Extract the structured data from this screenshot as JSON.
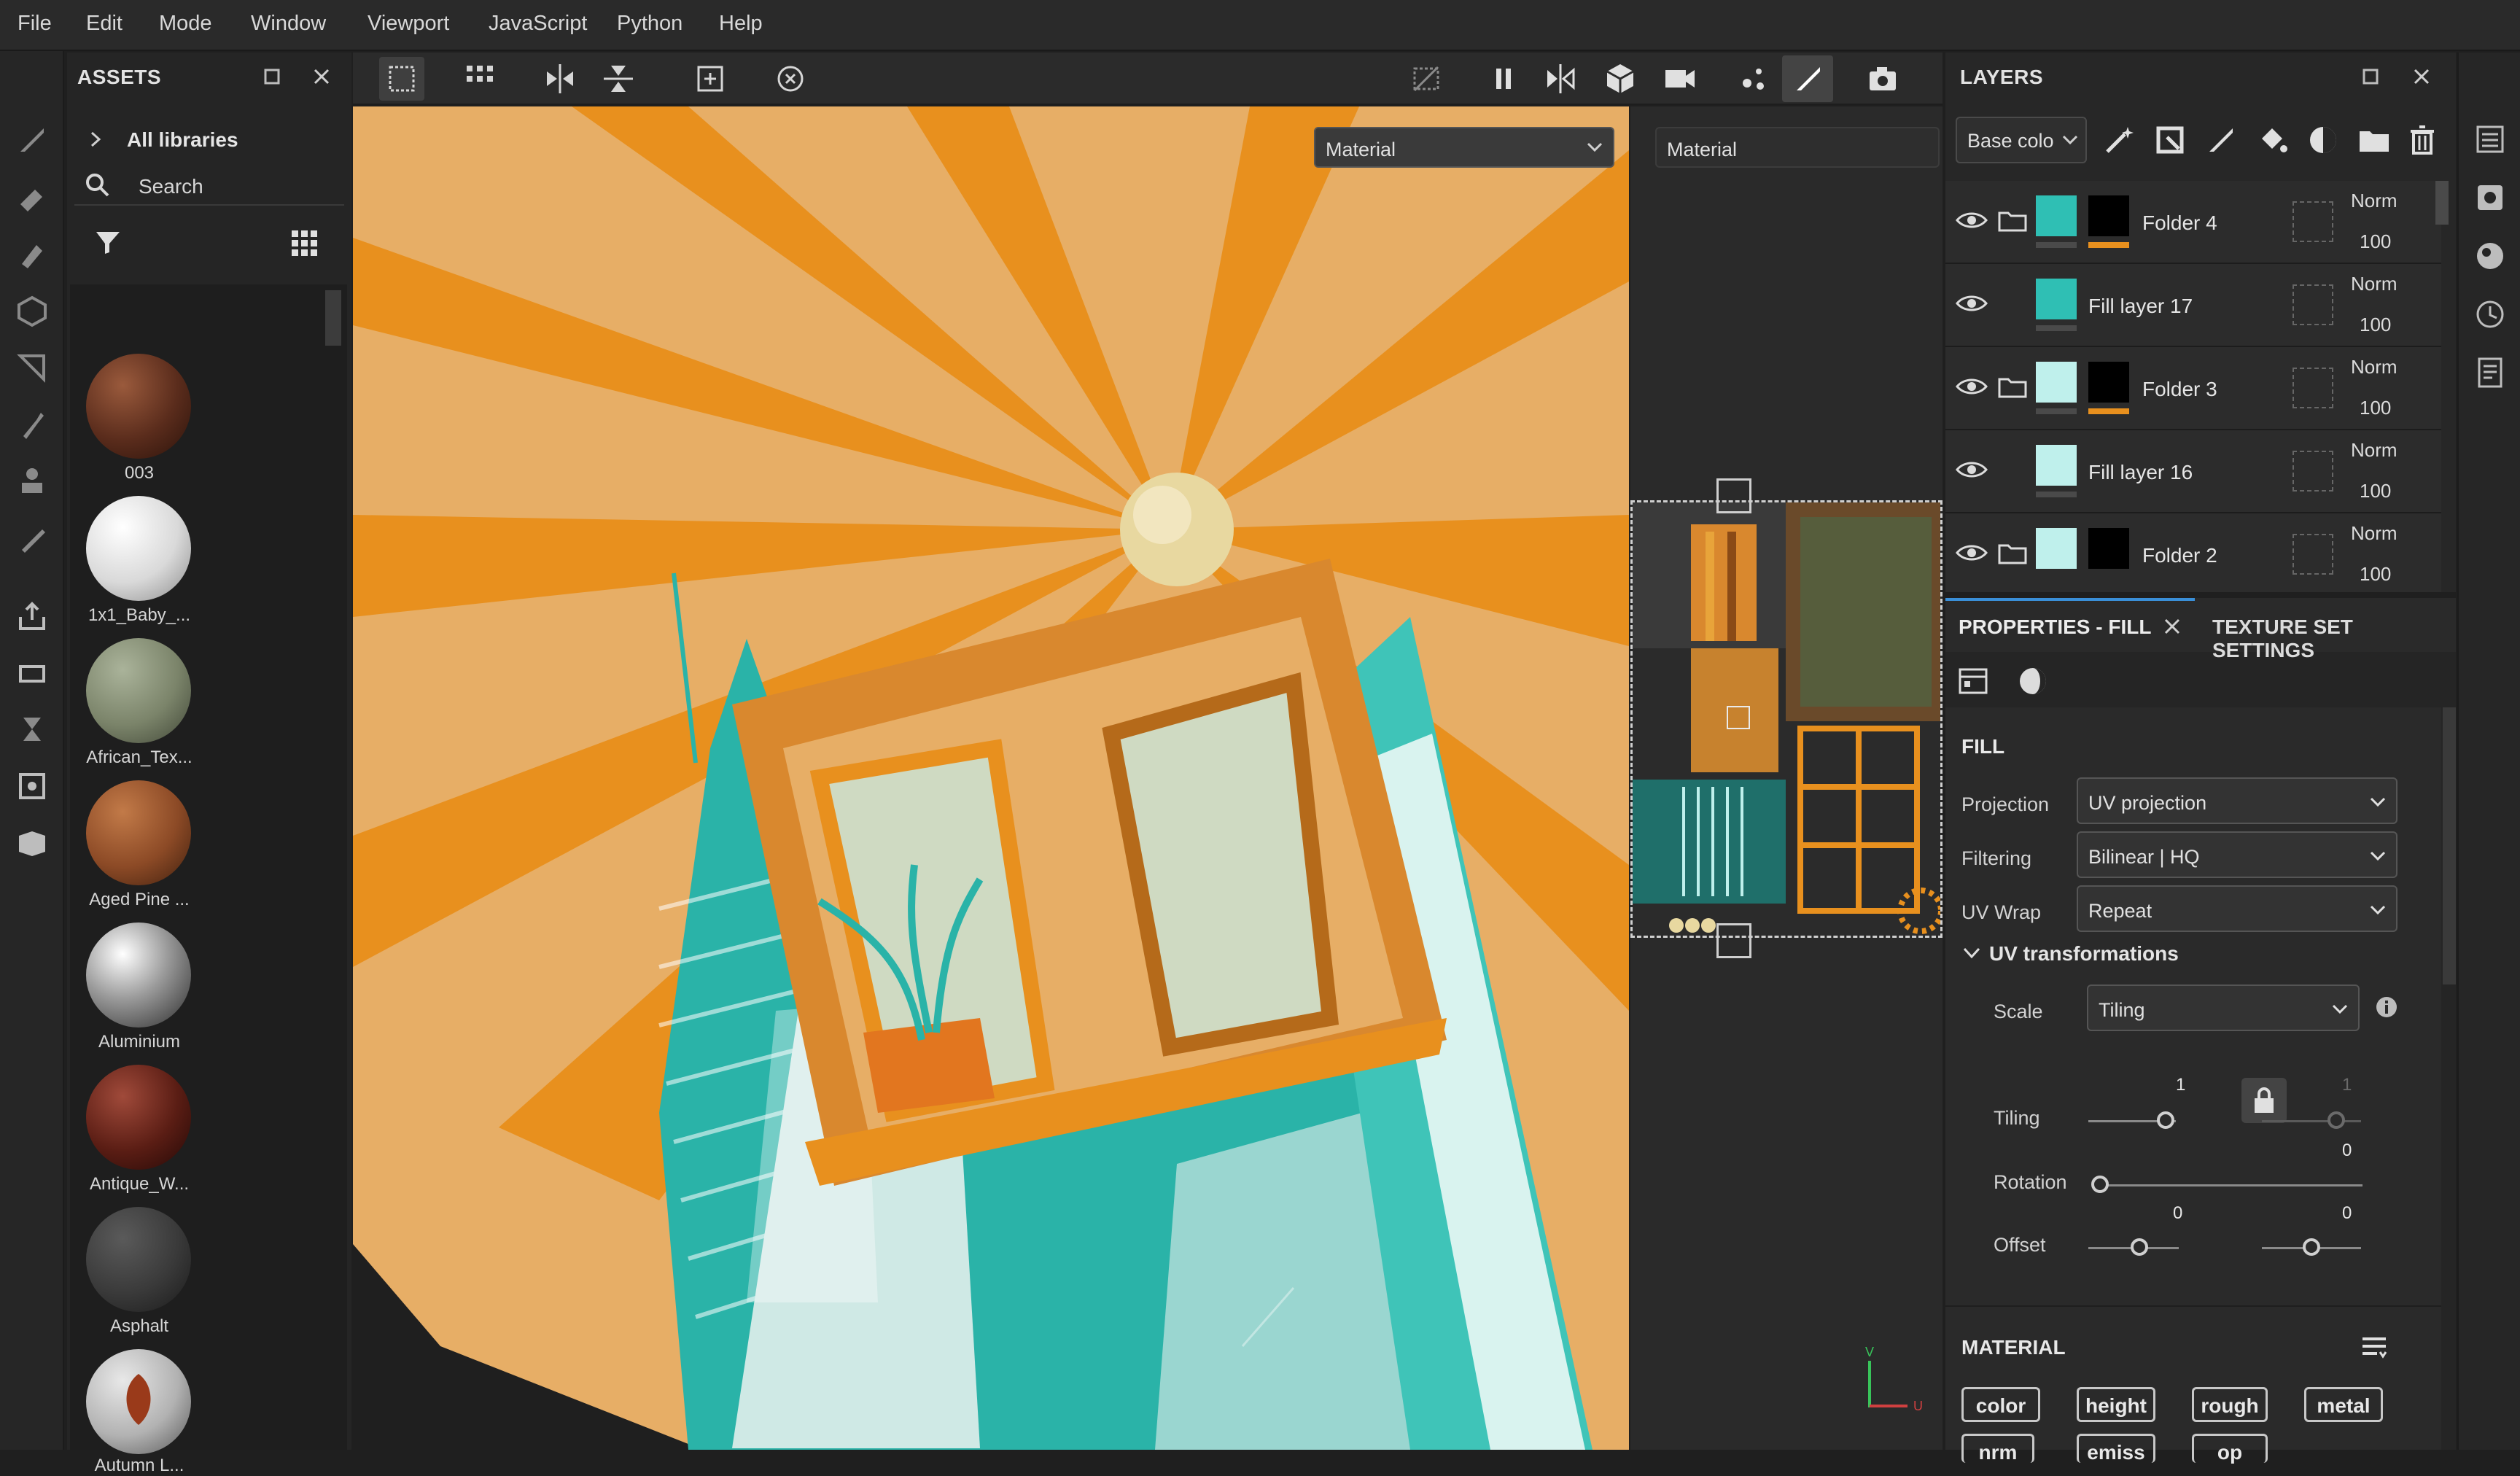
{
  "menu": [
    "File",
    "Edit",
    "Mode",
    "Window",
    "Viewport",
    "JavaScript",
    "Python",
    "Help"
  ],
  "assets": {
    "title": "ASSETS",
    "all_libraries": "All libraries",
    "search_placeholder": "Search",
    "items": [
      {
        "label": "003",
        "color": "#5a2c1c"
      },
      {
        "label": "1x1_Baby_...",
        "color": "#d9d9d9"
      },
      {
        "label": "African_Tex...",
        "color": "#7b846a"
      },
      {
        "label": "Aged Pine ...",
        "color": "#8c4a26"
      },
      {
        "label": "Aluminium",
        "color": "#b9b9b9"
      },
      {
        "label": "Antique_W...",
        "color": "#5a1d14"
      },
      {
        "label": "Asphalt",
        "color": "#3a3a3a"
      },
      {
        "label": "Autumn L...",
        "color": "#b2b2b2"
      }
    ]
  },
  "viewport": {
    "material_dropdown_3d": "Material",
    "material_dropdown_2d": "Material",
    "axis_v": "V",
    "axis_u": "U"
  },
  "layers": {
    "title": "LAYERS",
    "channel_select": "Base colo",
    "rows": [
      {
        "name": "Folder 4",
        "type": "folder",
        "blend": "Norm",
        "opacity": "100",
        "swatch": "#2fbfb4"
      },
      {
        "name": "Fill layer 17",
        "type": "fill",
        "blend": "Norm",
        "opacity": "100",
        "swatch": "#2fbfb4"
      },
      {
        "name": "Folder 3",
        "type": "folder",
        "blend": "Norm",
        "opacity": "100",
        "swatch": "#bff0ec"
      },
      {
        "name": "Fill layer 16",
        "type": "fill",
        "blend": "Norm",
        "opacity": "100",
        "swatch": "#bff0ec"
      },
      {
        "name": "Folder 2",
        "type": "folder",
        "blend": "Norm",
        "opacity": "100",
        "swatch": "#bff0ec"
      }
    ]
  },
  "properties": {
    "tab_active": "PROPERTIES - FILL",
    "tab_other": "TEXTURE SET SETTINGS",
    "section_fill": "FILL",
    "projection_label": "Projection",
    "projection_value": "UV projection",
    "filtering_label": "Filtering",
    "filtering_value": "Bilinear | HQ",
    "uvwrap_label": "UV Wrap",
    "uvwrap_value": "Repeat",
    "uv_transformations": "UV transformations",
    "scale_label": "Scale",
    "scale_value": "Tiling",
    "tiling_label": "Tiling",
    "tiling_u": "1",
    "tiling_v": "1",
    "rotation_label": "Rotation",
    "rotation_value": "0",
    "offset_label": "Offset",
    "offset_u": "0",
    "offset_v": "0",
    "section_material": "MATERIAL",
    "channels": [
      "color",
      "height",
      "rough",
      "metal",
      "nrm",
      "emiss",
      "op"
    ]
  },
  "colors": {
    "orange": "#e8901e",
    "light_orange": "#e7ae66",
    "teal": "#2fbfb4",
    "accent_blue": "#3a8fd8"
  }
}
